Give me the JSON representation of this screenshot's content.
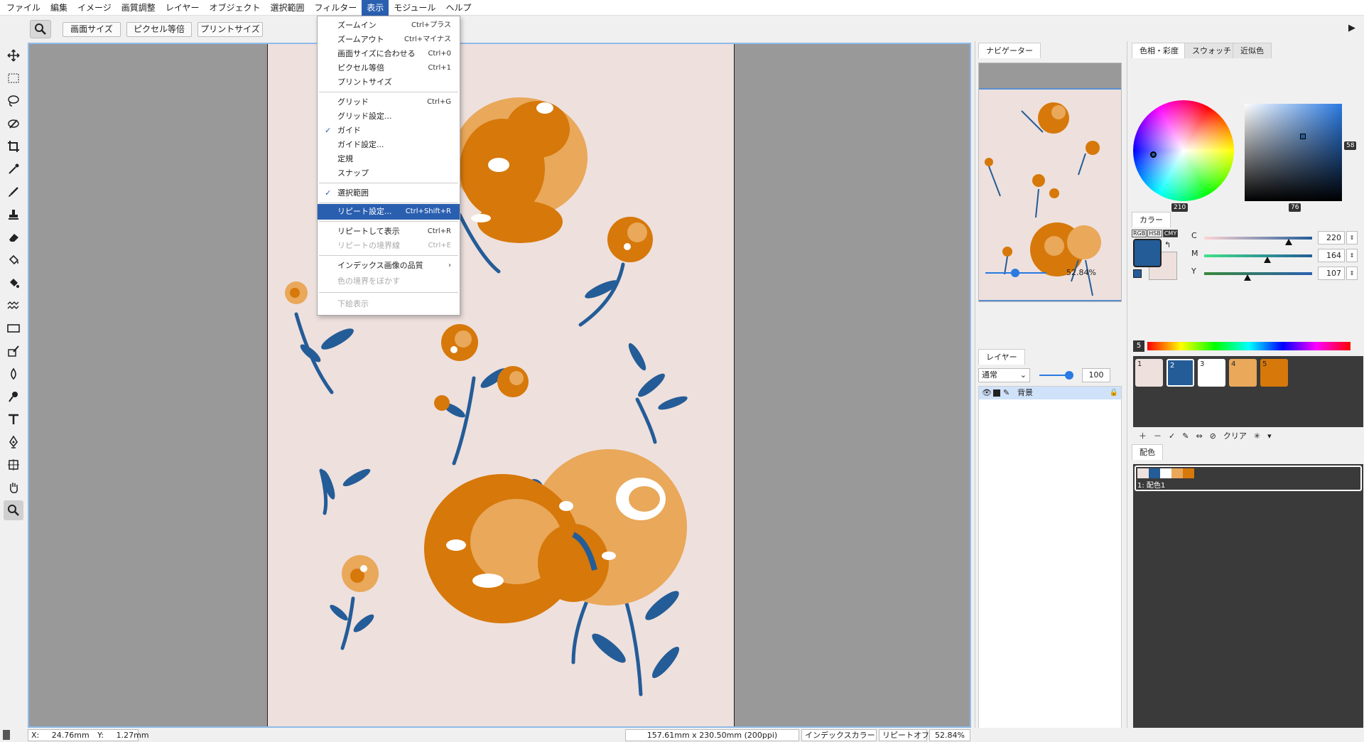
{
  "menubar": {
    "items": [
      "ファイル",
      "編集",
      "イメージ",
      "画質調整",
      "レイヤー",
      "オブジェクト",
      "選択範囲",
      "フィルター",
      "表示",
      "モジュール",
      "ヘルプ"
    ]
  },
  "optbar": {
    "buttons": [
      "画面サイズ",
      "ピクセル等倍",
      "プリントサイズ"
    ]
  },
  "view_menu": {
    "items": [
      {
        "label": "ズームイン",
        "shortcut": "Ctrl+プラス"
      },
      {
        "label": "ズームアウト",
        "shortcut": "Ctrl+マイナス"
      },
      {
        "label": "画面サイズに合わせる",
        "shortcut": "Ctrl+0"
      },
      {
        "label": "ピクセル等倍",
        "shortcut": "Ctrl+1"
      },
      {
        "label": "プリントサイズ",
        "shortcut": ""
      },
      {
        "label": "グリッド",
        "shortcut": "Ctrl+G"
      },
      {
        "label": "グリッド設定...",
        "shortcut": ""
      },
      {
        "label": "ガイド",
        "shortcut": ""
      },
      {
        "label": "ガイド設定...",
        "shortcut": ""
      },
      {
        "label": "定規",
        "shortcut": ""
      },
      {
        "label": "スナップ",
        "shortcut": ""
      },
      {
        "label": "選択範囲",
        "shortcut": ""
      },
      {
        "label": "リピート設定...",
        "shortcut": "Ctrl+Shift+R"
      },
      {
        "label": "リピートして表示",
        "shortcut": "Ctrl+R"
      },
      {
        "label": "リピートの境界線",
        "shortcut": "Ctrl+E"
      },
      {
        "label": "インデックス画像の品質",
        "shortcut": "›"
      },
      {
        "label": "色の境界をぼかす",
        "shortcut": ""
      },
      {
        "label": "下絵表示",
        "shortcut": ""
      }
    ]
  },
  "navigator": {
    "tab": "ナビゲーター",
    "zoom": "52.84%"
  },
  "layers": {
    "tab": "レイヤー",
    "blend_mode": "通常",
    "opacity": "100",
    "layer_name": "背景"
  },
  "color_panel": {
    "tabs": [
      "色相・彩度",
      "スウォッチ",
      "近似色"
    ],
    "hue": "210",
    "value": "76",
    "saturation": "58"
  },
  "color_values": {
    "tab": "カラー",
    "modes": [
      "RGB",
      "HSB",
      "CMY"
    ],
    "channels": [
      {
        "name": "C",
        "value": "220"
      },
      {
        "name": "M",
        "value": "164"
      },
      {
        "name": "Y",
        "value": "107"
      }
    ],
    "count": "5"
  },
  "palette": {
    "swatches": [
      {
        "index": "1",
        "color": "#eee0dd"
      },
      {
        "index": "2",
        "color": "#245c97"
      },
      {
        "index": "3",
        "color": "#ffffff"
      },
      {
        "index": "4",
        "color": "#e9a85a"
      },
      {
        "index": "5",
        "color": "#d6780a"
      }
    ],
    "clear_label": "クリア"
  },
  "scheme": {
    "tab": "配色",
    "name": "1: 配色1"
  },
  "statusbar": {
    "x_label": "X:",
    "x_value": "24.76mm",
    "y_label": "Y:",
    "y_value": "1.27mm",
    "doc_size": "157.61mm x 230.50mm (200ppi)",
    "color_mode": "インデックスカラー",
    "repeat": "リピートオフ",
    "zoom": "52.84%"
  },
  "colors": {
    "accent": "#2a5fb0",
    "canvas_bg": "#999999",
    "artboard": "#eee0dd",
    "blue": "#245c97",
    "light_orange": "#e9a85a",
    "dark_orange": "#d6780a"
  }
}
